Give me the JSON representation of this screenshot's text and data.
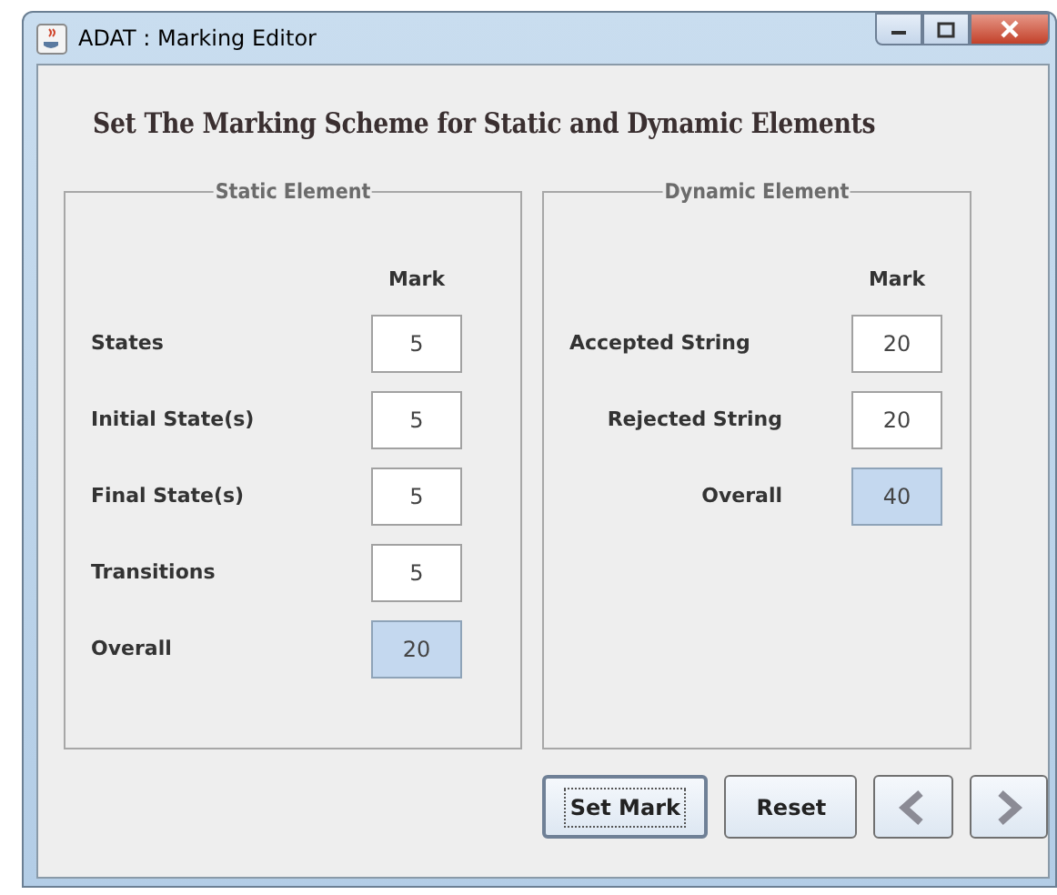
{
  "window": {
    "title": "ADAT : Marking Editor"
  },
  "heading": "Set The Marking Scheme for Static and Dynamic Elements",
  "panels": [
    {
      "title": "Static Element",
      "column_header": "Mark",
      "rows": [
        {
          "label": "States",
          "value": "5",
          "kind": "input"
        },
        {
          "label": "Initial State(s)",
          "value": "5",
          "kind": "input"
        },
        {
          "label": "Final State(s)",
          "value": "5",
          "kind": "input"
        },
        {
          "label": "Transitions",
          "value": "5",
          "kind": "input"
        },
        {
          "label": "Overall",
          "value": "20",
          "kind": "total"
        }
      ]
    },
    {
      "title": "Dynamic Element",
      "column_header": "Mark",
      "rows": [
        {
          "label": "Accepted String",
          "value": "20",
          "kind": "input"
        },
        {
          "label": "Rejected String",
          "value": "20",
          "kind": "input"
        },
        {
          "label": "Overall",
          "value": "40",
          "kind": "total"
        }
      ]
    }
  ],
  "buttons": [
    {
      "kind": "text",
      "label": "Set Mark",
      "focused": true
    },
    {
      "kind": "text",
      "label": "Reset",
      "focused": false
    },
    {
      "kind": "previous",
      "focused": false
    },
    {
      "kind": "next",
      "focused": false
    }
  ]
}
